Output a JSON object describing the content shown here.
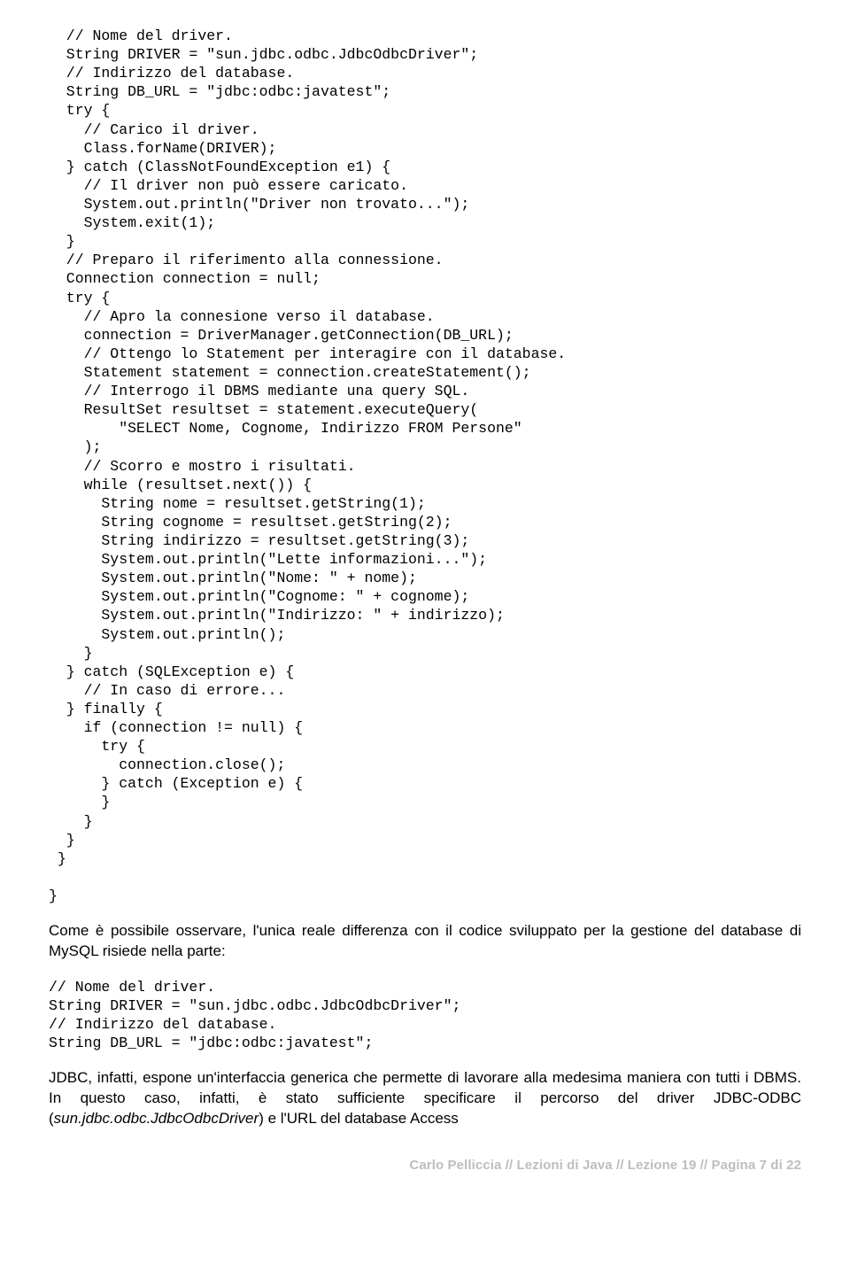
{
  "code1": "  // Nome del driver.\n  String DRIVER = \"sun.jdbc.odbc.JdbcOdbcDriver\";\n  // Indirizzo del database.\n  String DB_URL = \"jdbc:odbc:javatest\";\n  try {\n    // Carico il driver.\n    Class.forName(DRIVER);\n  } catch (ClassNotFoundException e1) {\n    // Il driver non può essere caricato.\n    System.out.println(\"Driver non trovato...\");\n    System.exit(1);\n  }\n  // Preparo il riferimento alla connessione.\n  Connection connection = null;\n  try {\n    // Apro la connesione verso il database.\n    connection = DriverManager.getConnection(DB_URL);\n    // Ottengo lo Statement per interagire con il database.\n    Statement statement = connection.createStatement();\n    // Interrogo il DBMS mediante una query SQL.\n    ResultSet resultset = statement.executeQuery(\n        \"SELECT Nome, Cognome, Indirizzo FROM Persone\"\n    );\n    // Scorro e mostro i risultati.\n    while (resultset.next()) {\n      String nome = resultset.getString(1);\n      String cognome = resultset.getString(2);\n      String indirizzo = resultset.getString(3);\n      System.out.println(\"Lette informazioni...\");\n      System.out.println(\"Nome: \" + nome);\n      System.out.println(\"Cognome: \" + cognome);\n      System.out.println(\"Indirizzo: \" + indirizzo);\n      System.out.println();\n    }\n  } catch (SQLException e) {\n    // In caso di errore...\n  } finally {\n    if (connection != null) {\n      try {\n        connection.close();\n      } catch (Exception e) {\n      }\n    }\n  }\n }\n\n}",
  "prose1": "Come è possibile osservare, l'unica reale differenza con il codice sviluppato per la gestione del database di MySQL risiede nella parte:",
  "code2": "// Nome del driver.\nString DRIVER = \"sun.jdbc.odbc.JdbcOdbcDriver\";\n// Indirizzo del database.\nString DB_URL = \"jdbc:odbc:javatest\";",
  "prose2_a": "JDBC, infatti, espone un'interfaccia generica che permette di lavorare alla medesima maniera con tutti i DBMS. In questo caso, infatti, è stato sufficiente specificare il percorso del driver JDBC-ODBC (",
  "prose2_i": "sun.jdbc.odbc.JdbcOdbcDriver",
  "prose2_b": ") e l'URL del database Access",
  "footer": "Carlo Pelliccia // Lezioni di Java // Lezione 19 // Pagina 7 di 22"
}
